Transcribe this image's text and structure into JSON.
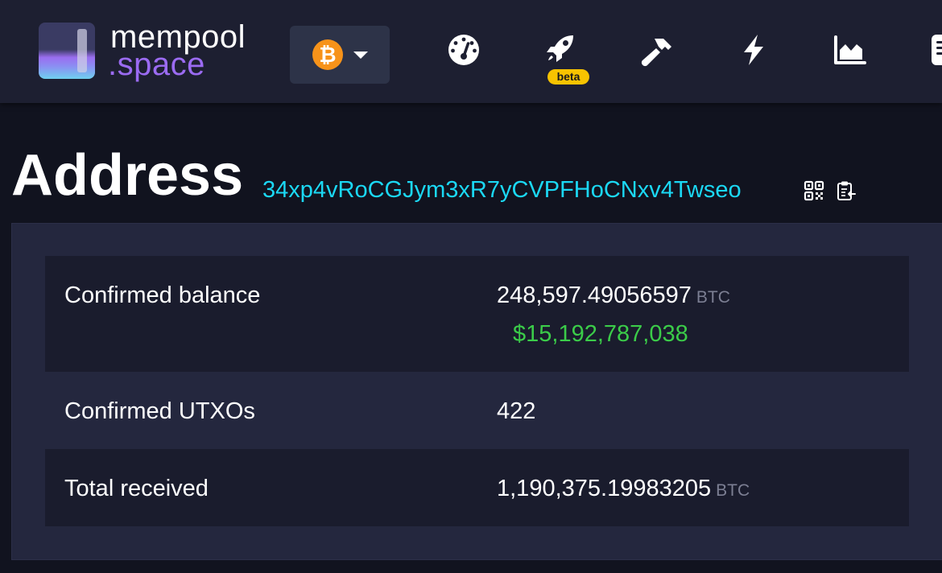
{
  "brand": {
    "line1": "mempool",
    "line2": ".space"
  },
  "network": {
    "symbol": "₿",
    "color": "#f7931a"
  },
  "nav": {
    "icons": [
      "dashboard-icon",
      "rocket-icon",
      "hammer-icon",
      "lightning-icon",
      "chart-icon",
      "docs-icon"
    ],
    "beta_label": "beta"
  },
  "page": {
    "title": "Address",
    "address": "34xp4vRoCGJym3xR7yCVPFHoCNxv4Twseo"
  },
  "details": {
    "confirmed_balance": {
      "label": "Confirmed balance",
      "value": "248,597.49056597",
      "unit": "BTC",
      "fiat": "$15,192,787,038"
    },
    "confirmed_utxos": {
      "label": "Confirmed UTXOs",
      "value": "422"
    },
    "total_received": {
      "label": "Total received",
      "value": "1,190,375.19983205",
      "unit": "BTC"
    }
  },
  "colors": {
    "accent_link": "#1bd8f4",
    "fiat_green": "#3bcc49",
    "brand_purple": "#9b6bf2",
    "beta_badge": "#f7c300"
  }
}
